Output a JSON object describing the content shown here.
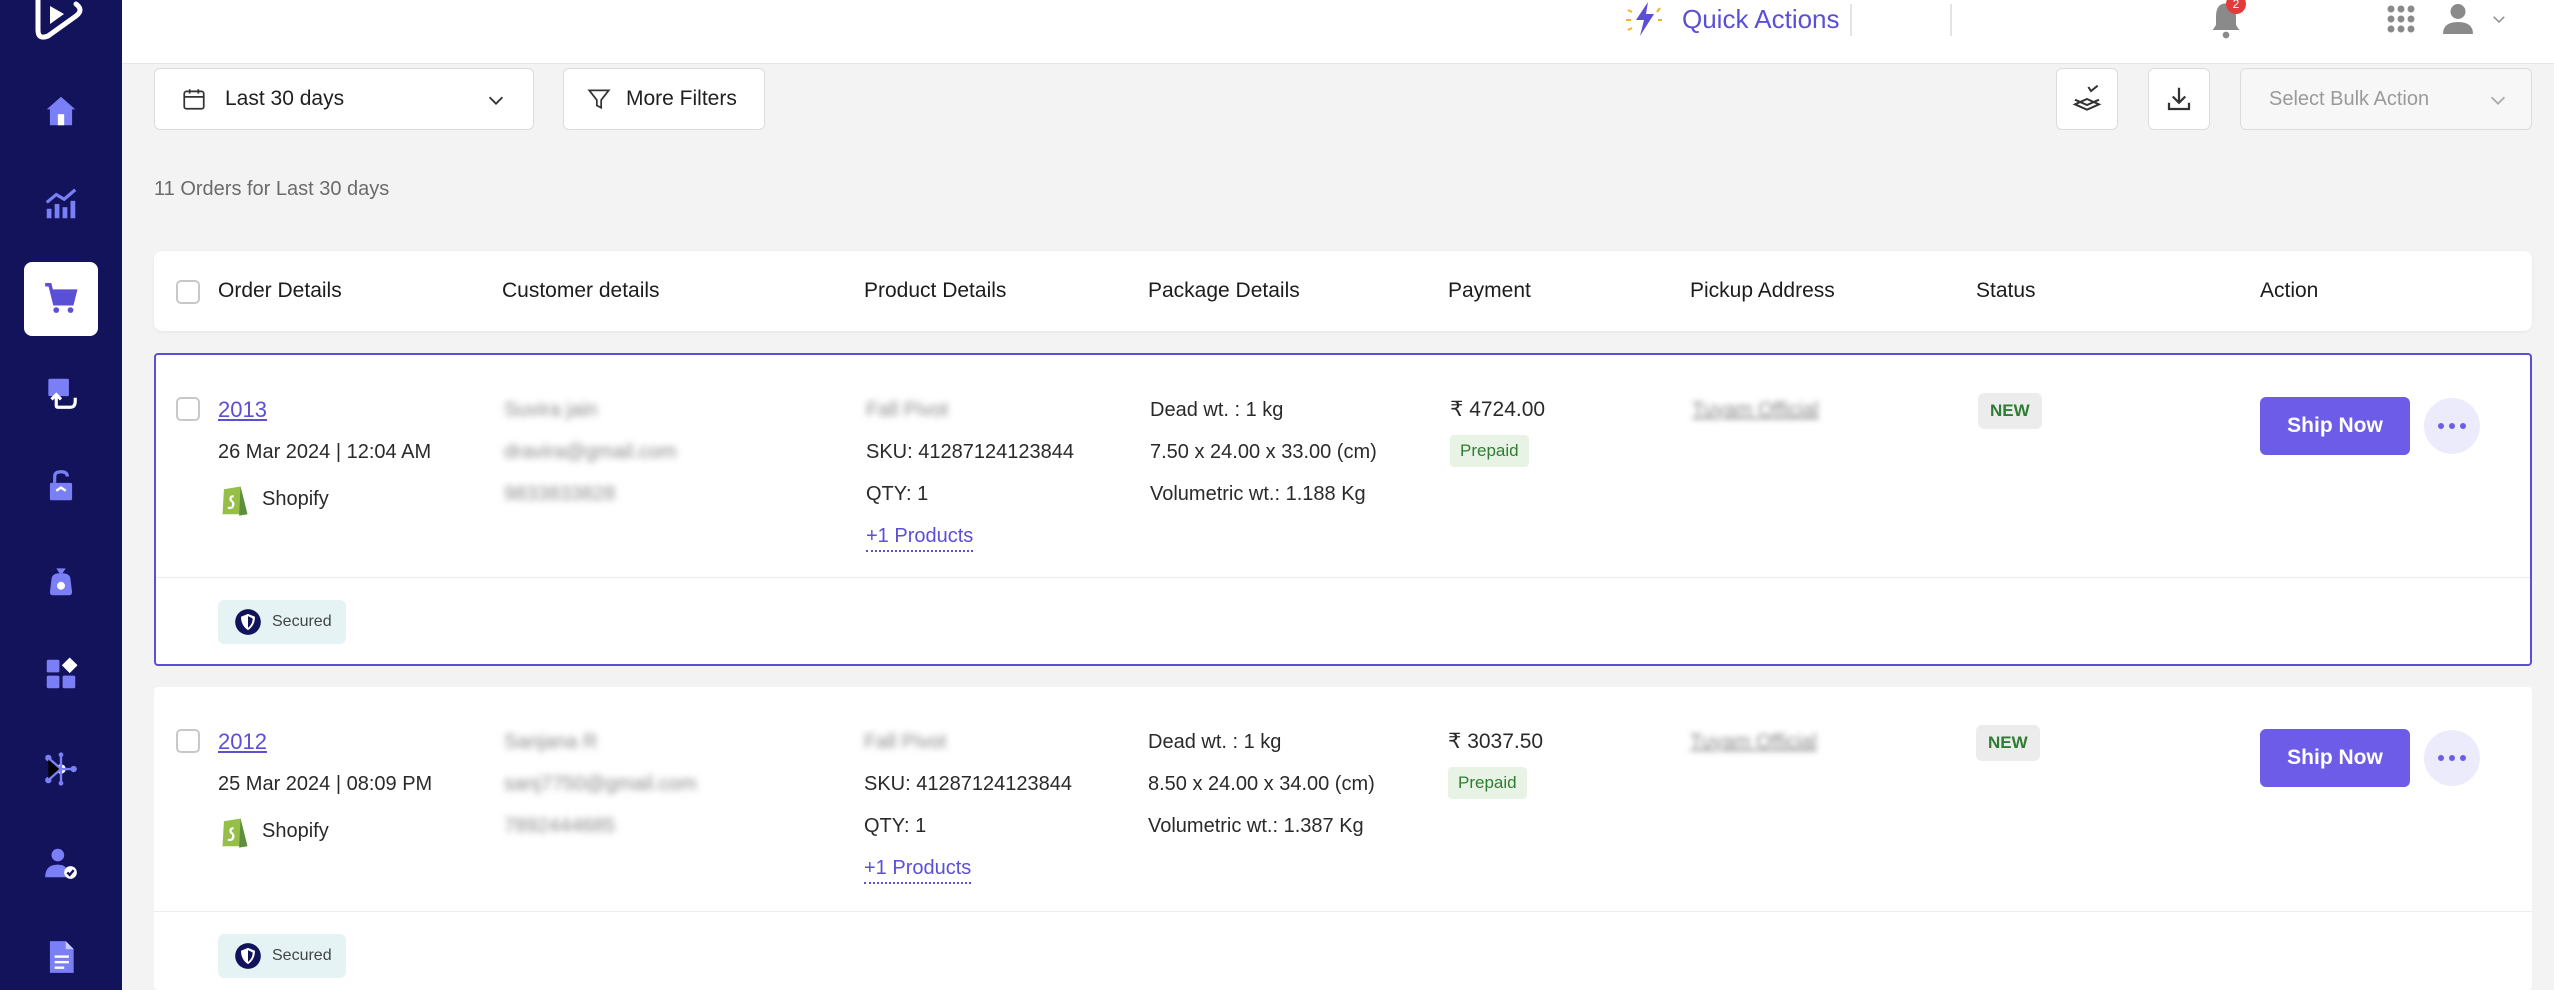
{
  "topbar": {
    "quick_actions_label": "Quick Actions",
    "notification_count": "2"
  },
  "filters": {
    "date_range_label": "Last 30 days",
    "more_filters_label": "More Filters",
    "bulk_action_placeholder": "Select Bulk Action"
  },
  "summary": {
    "count_text": "11 Orders for Last 30 days"
  },
  "table": {
    "headers": [
      "Order Details",
      "Customer details",
      "Product Details",
      "Package Details",
      "Payment",
      "Pickup Address",
      "Status",
      "Action"
    ],
    "rows": [
      {
        "order_id": "2013",
        "order_datetime": "26 Mar 2024 | 12:04 AM",
        "channel": "Shopify",
        "customer_name": "Suvira jain",
        "customer_email": "dravira@gmail.com",
        "customer_phone": "9833833828",
        "product_name": "Fall Pivot",
        "sku": "SKU: 41287124123844",
        "qty": "QTY: 1",
        "more_products": "+1 Products",
        "dead_wt": "Dead wt. : 1 kg",
        "dimensions": "7.50 x 24.00 x 33.00 (cm)",
        "volumetric_wt": "Volumetric wt.:  1.188 Kg",
        "amount": "₹ 4724.00",
        "payment_type": "Prepaid",
        "pickup": "Tuyam Official",
        "status": "NEW",
        "action_label": "Ship Now",
        "secured_label": "Secured"
      },
      {
        "order_id": "2012",
        "order_datetime": "25 Mar 2024 | 08:09 PM",
        "channel": "Shopify",
        "customer_name": "Sanjana R",
        "customer_email": "sanj7750@gmail.com",
        "customer_phone": "7892444685",
        "product_name": "Fall Pivot",
        "sku": "SKU: 41287124123844",
        "qty": "QTY: 1",
        "more_products": "+1 Products",
        "dead_wt": "Dead wt. : 1 kg",
        "dimensions": "8.50 x 24.00 x 34.00 (cm)",
        "volumetric_wt": "Volumetric wt.:  1.387 Kg",
        "amount": "₹ 3037.50",
        "payment_type": "Prepaid",
        "pickup": "Tuyam Official",
        "status": "NEW",
        "action_label": "Ship Now",
        "secured_label": "Secured"
      }
    ]
  },
  "colors": {
    "sidebar": "#12135b",
    "accent": "#6c5ce7",
    "status_green": "#2e7d32"
  },
  "icons": {
    "sidebar": [
      "home-icon",
      "analytics-icon",
      "cart-icon",
      "returns-icon",
      "unlock-icon",
      "wallet-bag-icon",
      "apps-icon",
      "integrations-icon",
      "user-check-icon",
      "document-icon"
    ]
  }
}
